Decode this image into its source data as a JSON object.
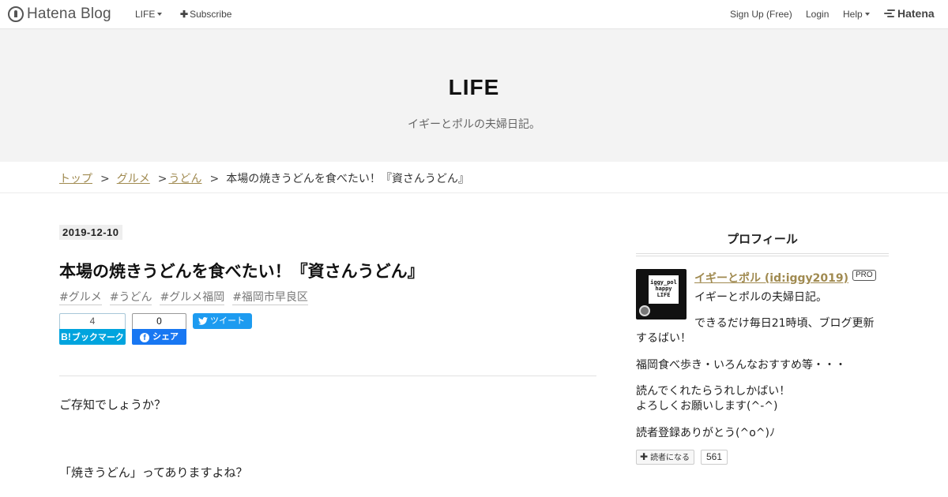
{
  "globalbar": {
    "logo_text": "Hatena Blog",
    "life_menu": "LIFE",
    "subscribe": "Subscribe",
    "signup": "Sign Up (Free)",
    "login": "Login",
    "help": "Help",
    "brand": "Hatena"
  },
  "header": {
    "title": "LIFE",
    "description": "イギーとポルの夫婦日記。"
  },
  "breadcrumb": {
    "sep": ">",
    "items": [
      "トップ",
      "グルメ",
      "うどん"
    ],
    "current": "本場の焼きうどんを食べたい！『資さんうどん』"
  },
  "entry": {
    "date": "2019-12-10",
    "title": "本場の焼きうどんを食べたい！『資さんうどん』",
    "tags": [
      "#グルメ",
      "#うどん",
      "#グルメ福岡",
      "#福岡市早良区"
    ],
    "share": {
      "hatena_count": "4",
      "hatena_label": "ブックマーク",
      "hatena_mark": "B!",
      "fb_count": "0",
      "fb_label": "シェア",
      "tweet_label": "ツイート"
    },
    "paragraphs": [
      "ご存知でしょうか？",
      "「焼きうどん」ってありますよね？"
    ]
  },
  "sidebar": {
    "heading": "プロフィール",
    "avatar_text": [
      "iggy_pol",
      "happy",
      "LIFE"
    ],
    "name": "イギーとポル (id:iggy2019)",
    "pro": "PRO",
    "intro": "イギーとポルの夫婦日記。",
    "lines": [
      "できるだけ毎日21時頃、ブログ更新",
      "するばい！",
      "福岡食べ歩き・いろんなおすすめ等・・・",
      "読んでくれたらうれしかばい！",
      "よろしくお願いします(^-^)",
      "読者登録ありがとう(^o^)ﾉ"
    ],
    "reader_button": "読者になる",
    "reader_count": "561"
  },
  "colors": {
    "link": "#a08a50",
    "hatena_blue": "#00a4de",
    "facebook_blue": "#1877f2",
    "twitter_blue": "#1d9bf0",
    "header_bg": "#f3f3f3"
  }
}
